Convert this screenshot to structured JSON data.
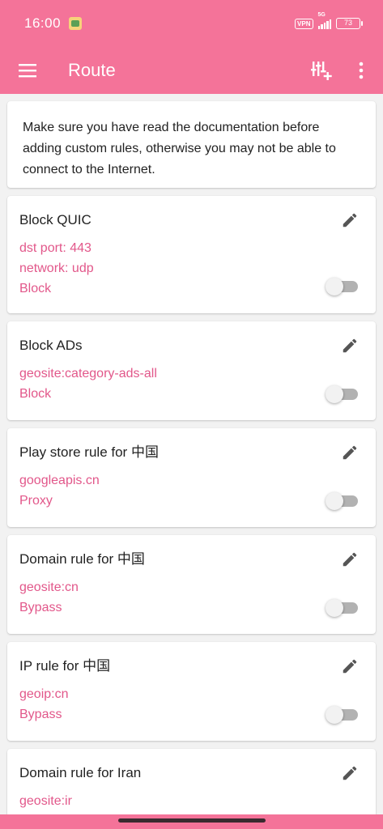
{
  "status_bar": {
    "time": "16:00",
    "vpn": "VPN",
    "network": "5G",
    "battery": "73"
  },
  "app_bar": {
    "title": "Route",
    "menu_icon": "menu-icon",
    "add_icon": "add-rule-icon",
    "more_icon": "more-vert-icon"
  },
  "info": {
    "text": "Make sure you have read the documentation before adding custom rules, otherwise you may not be able to connect to the Internet."
  },
  "rules": [
    {
      "title": "Block QUIC",
      "lines": [
        "dst port: 443",
        "network: udp",
        "Block"
      ],
      "enabled": false
    },
    {
      "title": "Block ADs",
      "lines": [
        "geosite:category-ads-all",
        "Block"
      ],
      "enabled": false
    },
    {
      "title": "Play store rule for 中国",
      "lines": [
        "googleapis.cn",
        "Proxy"
      ],
      "enabled": false
    },
    {
      "title": "Domain rule for 中国",
      "lines": [
        "geosite:cn",
        "Bypass"
      ],
      "enabled": false
    },
    {
      "title": "IP rule for 中国",
      "lines": [
        "geoip:cn",
        "Bypass"
      ],
      "enabled": false
    },
    {
      "title": "Domain rule for Iran",
      "lines": [
        "geosite:ir"
      ],
      "enabled": false
    }
  ],
  "colors": {
    "primary": "#f47399",
    "rule_text": "#e2578a"
  }
}
